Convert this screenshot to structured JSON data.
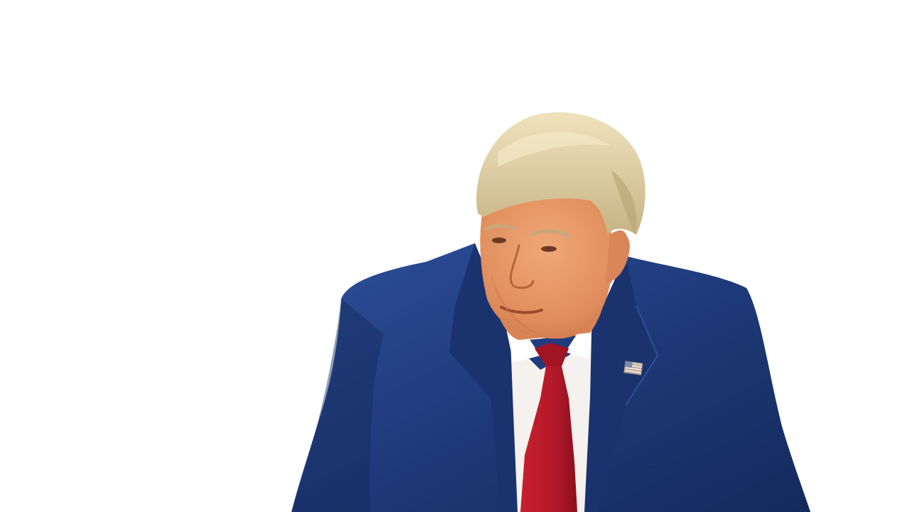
{
  "scene": {
    "subject": "man-in-suit-cutout",
    "background": "#ffffff",
    "colors": {
      "suit": "#1f3a7a",
      "suit_shadow": "#142a5c",
      "suit_highlight": "#2d4f9a",
      "shirt": "#f4f1ee",
      "tie": "#b3182a",
      "tie_shadow": "#8a0f1e",
      "skin": "#e79a6b",
      "skin_shadow": "#c9744a",
      "hair": "#e2d3a8",
      "hair_shadow": "#c7b485",
      "pin": "#e8e2d6"
    },
    "icons": [
      "flag-lapel-pin-icon"
    ]
  }
}
